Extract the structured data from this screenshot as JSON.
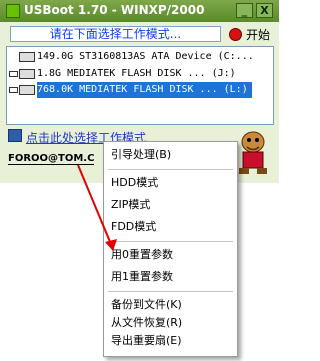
{
  "window": {
    "title": "USBoot 1.70 - WINXP/2000",
    "minimize_label": "_",
    "close_label": "X"
  },
  "hint": "请在下面选择工作模式...",
  "start_label": "开始",
  "devices": [
    {
      "text": "149.0G  ST3160813AS ATA Device (C:...",
      "icon": "hdd-icon"
    },
    {
      "text": "1.8G    MEDIATEK  FLASH DISK ...  (J:)",
      "icon": "usb-drive-icon"
    },
    {
      "text": "768.0K  MEDIATEK  FLASH DISK ...  (L:)",
      "icon": "usb-drive-icon",
      "selected": true
    }
  ],
  "info_link": "点击此处选择工作模式",
  "email": "FOROO@TOM.C",
  "context_menu": {
    "items": [
      "引导处理(B)",
      "HDD模式",
      "ZIP模式",
      "FDD模式",
      "用0重置参数",
      "用1重置参数",
      "备份到文件(K)",
      "从文件恢复(R)",
      "导出重要扇(E)"
    ]
  },
  "colors": {
    "accent_selected": "#1e74d6",
    "titlebar": "#5a8a2a",
    "arrow": "#e00000"
  }
}
